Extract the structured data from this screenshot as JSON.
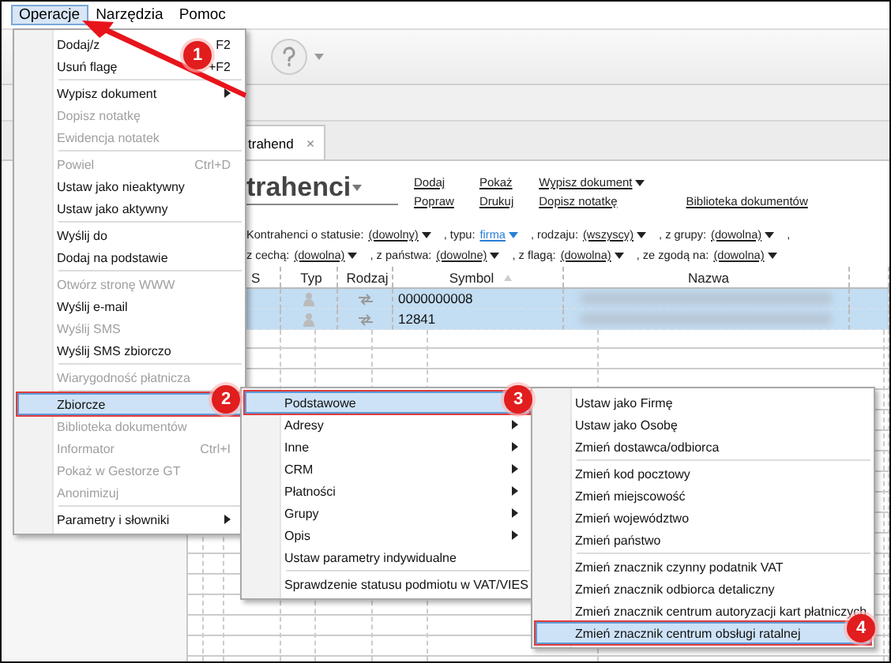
{
  "menubar": [
    {
      "label": "Operacje",
      "selected": true
    },
    {
      "label": "Narzędzia",
      "selected": false
    },
    {
      "label": "Pomoc",
      "selected": false
    }
  ],
  "tab": {
    "label": "trahend",
    "close": "×"
  },
  "title": "trahenci",
  "action_columns": [
    {
      "items": [
        {
          "label": "Dodaj",
          "dropdown": false
        },
        {
          "label": "Popraw",
          "dropdown": false
        }
      ]
    },
    {
      "items": [
        {
          "label": "Pokaż",
          "dropdown": false
        },
        {
          "label": "Drukuj",
          "dropdown": false
        }
      ]
    },
    {
      "items": [
        {
          "label": "Wypisz dokument",
          "dropdown": true
        },
        {
          "label": "Dopisz notatkę",
          "dropdown": false
        }
      ]
    },
    {
      "items": [
        {
          "label": "Biblioteka dokumentów",
          "dropdown": false
        }
      ]
    }
  ],
  "filter_lines": [
    [
      {
        "kind": "text",
        "text": "Kontrahenci o statusie:"
      },
      {
        "kind": "choice",
        "text": "(dowolny)"
      },
      {
        "kind": "text",
        "text": ", typu:"
      },
      {
        "kind": "set",
        "text": "firma"
      },
      {
        "kind": "text",
        "text": ", rodzaju:"
      },
      {
        "kind": "choice",
        "text": "(wszyscy)"
      },
      {
        "kind": "text",
        "text": ", z grupy:"
      },
      {
        "kind": "choice",
        "text": "(dowolna)"
      },
      {
        "kind": "text",
        "text": ","
      }
    ],
    [
      {
        "kind": "text",
        "text": "z cechą:"
      },
      {
        "kind": "choice",
        "text": "(dowolna)"
      },
      {
        "kind": "text",
        "text": ", z państwa:"
      },
      {
        "kind": "choice",
        "text": "(dowolne)"
      },
      {
        "kind": "text",
        "text": ", z flagą:"
      },
      {
        "kind": "choice",
        "text": "(dowolna)"
      },
      {
        "kind": "text",
        "text": ", ze zgodą na:"
      },
      {
        "kind": "choice",
        "text": "(dowolna)"
      }
    ]
  ],
  "table": {
    "columns": [
      {
        "label": "S",
        "sorted": false
      },
      {
        "label": "Typ",
        "sorted": false
      },
      {
        "label": "Rodzaj",
        "sorted": false
      },
      {
        "label": "Symbol",
        "sorted": true
      },
      {
        "label": "Nazwa",
        "sorted": false
      }
    ],
    "rows": [
      {
        "symbol": "0000000008",
        "selected": true
      },
      {
        "symbol": "12841",
        "selected": true
      }
    ]
  },
  "menu": [
    {
      "kind": "item",
      "label": "Dodaj/z",
      "shortcut": "F2",
      "disabled": false,
      "submenu": false,
      "selected": false
    },
    {
      "kind": "item",
      "label": "Usuń flagę",
      "shortcut": "+F2",
      "disabled": false,
      "submenu": false,
      "selected": false
    },
    {
      "kind": "separator"
    },
    {
      "kind": "item",
      "label": "Wypisz dokument",
      "disabled": false,
      "submenu": true,
      "selected": false
    },
    {
      "kind": "item",
      "label": "Dopisz notatkę",
      "disabled": true,
      "submenu": false,
      "selected": false
    },
    {
      "kind": "item",
      "label": "Ewidencja notatek",
      "disabled": true,
      "submenu": false,
      "selected": false
    },
    {
      "kind": "separator"
    },
    {
      "kind": "item",
      "label": "Powiel",
      "shortcut": "Ctrl+D",
      "disabled": true,
      "submenu": false,
      "selected": false
    },
    {
      "kind": "item",
      "label": "Ustaw jako nieaktywny",
      "disabled": false,
      "submenu": false,
      "selected": false
    },
    {
      "kind": "item",
      "label": "Ustaw jako aktywny",
      "disabled": false,
      "submenu": false,
      "selected": false
    },
    {
      "kind": "separator"
    },
    {
      "kind": "item",
      "label": "Wyślij do",
      "disabled": false,
      "submenu": false,
      "selected": false
    },
    {
      "kind": "item",
      "label": "Dodaj na podstawie",
      "disabled": false,
      "submenu": false,
      "selected": false
    },
    {
      "kind": "separator"
    },
    {
      "kind": "item",
      "label": "Otwórz stronę WWW",
      "disabled": true,
      "submenu": false,
      "selected": false
    },
    {
      "kind": "item",
      "label": "Wyślij e-mail",
      "disabled": false,
      "submenu": false,
      "selected": false
    },
    {
      "kind": "item",
      "label": "Wyślij SMS",
      "disabled": true,
      "submenu": false,
      "selected": false
    },
    {
      "kind": "item",
      "label": "Wyślij SMS zbiorczo",
      "disabled": false,
      "submenu": false,
      "selected": false
    },
    {
      "kind": "separator"
    },
    {
      "kind": "item",
      "label": "Wiarygodność płatnicza",
      "disabled": true,
      "submenu": false,
      "selected": false
    },
    {
      "kind": "separator"
    },
    {
      "kind": "item",
      "label": "Zbiorcze",
      "disabled": false,
      "submenu": false,
      "selected": true
    },
    {
      "kind": "item",
      "label": "Biblioteka dokumentów",
      "disabled": true,
      "submenu": false,
      "selected": false
    },
    {
      "kind": "item",
      "label": "Informator",
      "shortcut": "Ctrl+I",
      "disabled": true,
      "submenu": false,
      "selected": false
    },
    {
      "kind": "item",
      "label": "Pokaż w Gestorze GT",
      "disabled": true,
      "submenu": false,
      "selected": false
    },
    {
      "kind": "item",
      "label": "Anonimizuj",
      "disabled": true,
      "submenu": false,
      "selected": false
    },
    {
      "kind": "separator"
    },
    {
      "kind": "item",
      "label": "Parametry i słowniki",
      "disabled": false,
      "submenu": true,
      "selected": false
    }
  ],
  "submenu": [
    {
      "kind": "item",
      "label": "Podstawowe",
      "disabled": false,
      "submenu": false,
      "selected": true
    },
    {
      "kind": "item",
      "label": "Adresy",
      "disabled": false,
      "submenu": true,
      "selected": false
    },
    {
      "kind": "item",
      "label": "Inne",
      "disabled": false,
      "submenu": true,
      "selected": false
    },
    {
      "kind": "item",
      "label": "CRM",
      "disabled": false,
      "submenu": true,
      "selected": false
    },
    {
      "kind": "item",
      "label": "Płatności",
      "disabled": false,
      "submenu": true,
      "selected": false
    },
    {
      "kind": "item",
      "label": "Grupy",
      "disabled": false,
      "submenu": true,
      "selected": false
    },
    {
      "kind": "item",
      "label": "Opis",
      "disabled": false,
      "submenu": true,
      "selected": false
    },
    {
      "kind": "item",
      "label": "Ustaw parametry indywidualne",
      "disabled": false,
      "submenu": false,
      "selected": false
    },
    {
      "kind": "separator"
    },
    {
      "kind": "item",
      "label": "Sprawdzenie statusu podmiotu w VAT/VIES",
      "disabled": false,
      "submenu": false,
      "selected": false
    }
  ],
  "submenu_2": [
    {
      "kind": "item",
      "label": "Ustaw jako Firmę",
      "disabled": false,
      "submenu": false,
      "selected": false
    },
    {
      "kind": "item",
      "label": "Ustaw jako Osobę",
      "disabled": false,
      "submenu": false,
      "selected": false
    },
    {
      "kind": "item",
      "label": "Zmień dostawca/odbiorca",
      "disabled": false,
      "submenu": false,
      "selected": false
    },
    {
      "kind": "separator"
    },
    {
      "kind": "item",
      "label": "Zmień kod pocztowy",
      "disabled": false,
      "submenu": false,
      "selected": false
    },
    {
      "kind": "item",
      "label": "Zmień miejscowość",
      "disabled": false,
      "submenu": false,
      "selected": false
    },
    {
      "kind": "item",
      "label": "Zmień województwo",
      "disabled": false,
      "submenu": false,
      "selected": false
    },
    {
      "kind": "item",
      "label": "Zmień państwo",
      "disabled": false,
      "submenu": false,
      "selected": false
    },
    {
      "kind": "separator"
    },
    {
      "kind": "item",
      "label": "Zmień znacznik czynny podatnik VAT",
      "disabled": false,
      "submenu": false,
      "selected": false
    },
    {
      "kind": "item",
      "label": "Zmień znacznik odbiorca detaliczny",
      "disabled": false,
      "submenu": false,
      "selected": false
    },
    {
      "kind": "item",
      "label": "Zmień znacznik centrum autoryzacji kart płatniczych",
      "disabled": false,
      "submenu": false,
      "selected": false
    },
    {
      "kind": "item",
      "label": "Zmień znacznik centrum obsługi ratalnej",
      "disabled": false,
      "submenu": false,
      "selected": true
    }
  ],
  "badges": [
    {
      "text": "1"
    },
    {
      "text": "2"
    },
    {
      "text": "3"
    },
    {
      "text": "4"
    }
  ]
}
